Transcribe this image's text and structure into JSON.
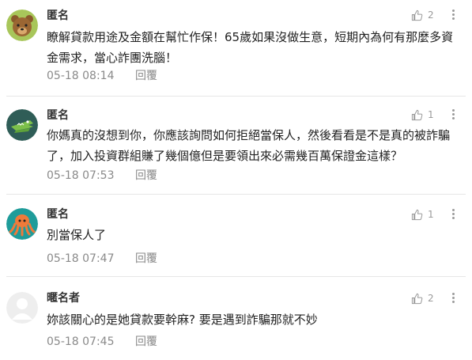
{
  "comments": [
    {
      "author": "匿名",
      "avatar": "bear-avatar",
      "likes": "2",
      "text": "瞭解貸款用途及金額在幫忙作保！65歲如果沒做生意，短期內為何有那麼多資金需求，當心詐團洗腦！",
      "time": "05-18 08:14",
      "reply": "回覆"
    },
    {
      "author": "匿名",
      "avatar": "crocodile-avatar",
      "likes": "1",
      "text": "你媽真的沒想到你，你應該詢問如何拒絕當保人，然後看看是不是真的被詐騙了，加入投資群組賺了幾個億但是要領出來必需幾百萬保證金這樣？",
      "time": "05-18 07:53",
      "reply": "回覆"
    },
    {
      "author": "匿名",
      "avatar": "octopus-avatar",
      "likes": "1",
      "text": "別當保人了",
      "time": "05-18 07:47",
      "reply": "回覆"
    },
    {
      "author": "暱名者",
      "avatar": "default-user-avatar",
      "likes": "2",
      "text": "妳該關心的是她貸款要幹麻? 要是遇到詐騙那就不妙",
      "time": "05-18 07:45",
      "reply": "回覆"
    }
  ],
  "colors": {
    "bear_bg": "#a8c65a",
    "crocodile_bg": "#2f5d57",
    "octopus_bg": "#1f9c9a",
    "default_bg": "#eeeeee"
  }
}
